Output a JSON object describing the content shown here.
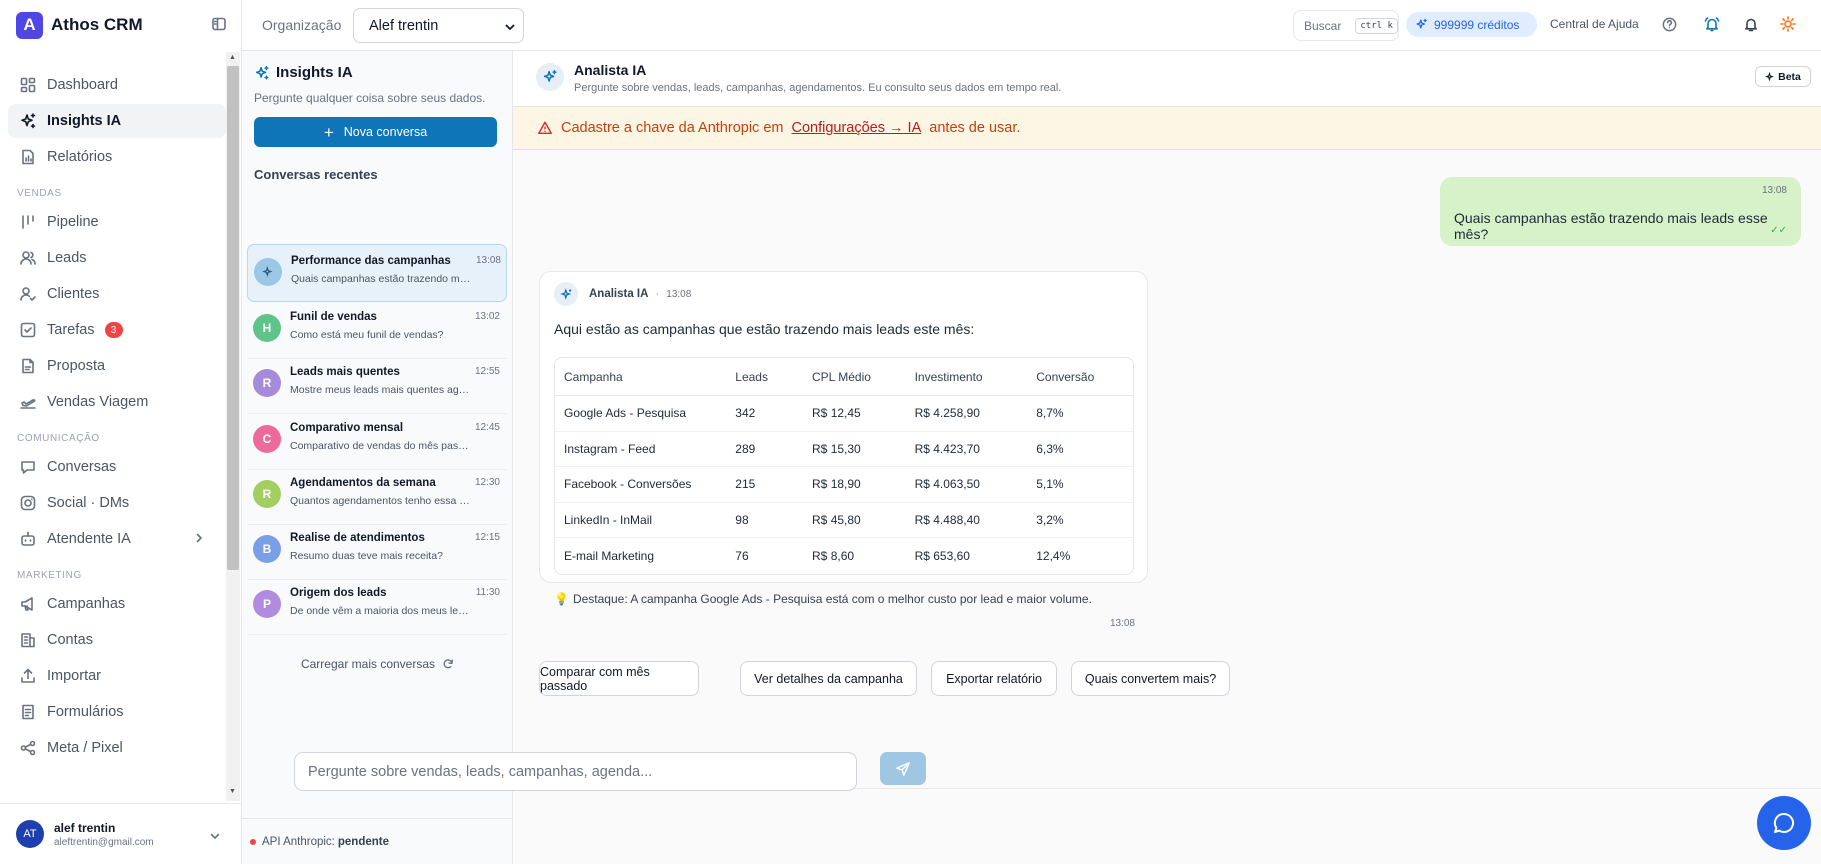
{
  "app": {
    "name": "Athos CRM",
    "logo_letter": "A"
  },
  "topbar": {
    "org_label": "Organização",
    "org_value": "Alef trentin",
    "search_label": "Buscar",
    "search_shortcut": "ctrl k",
    "credits": "999999 créditos",
    "help_link": "Central de Ajuda"
  },
  "sidebar": {
    "items_main": [
      {
        "label": "Dashboard",
        "icon": "dashboard-icon"
      },
      {
        "label": "Insights IA",
        "icon": "sparkles-icon",
        "active": true
      },
      {
        "label": "Relatórios",
        "icon": "file-chart-icon"
      }
    ],
    "section_vendas": "VENDAS",
    "items_vendas": [
      {
        "label": "Pipeline",
        "icon": "kanban-icon"
      },
      {
        "label": "Leads",
        "icon": "users-icon"
      },
      {
        "label": "Clientes",
        "icon": "user-check-icon"
      },
      {
        "label": "Tarefas",
        "icon": "checkbox-icon",
        "badge": "3"
      },
      {
        "label": "Proposta",
        "icon": "document-icon"
      },
      {
        "label": "Vendas Viagem",
        "icon": "plane-icon"
      }
    ],
    "section_comunicacao": "COMUNICAÇÃO",
    "items_comunicacao": [
      {
        "label": "Conversas",
        "icon": "chat-icon"
      },
      {
        "label": "Social · DMs",
        "icon": "instagram-icon"
      },
      {
        "label": "Atendente IA",
        "icon": "robot-icon",
        "has_chevron": true
      }
    ],
    "section_marketing": "MARKETING",
    "items_marketing": [
      {
        "label": "Campanhas",
        "icon": "megaphone-icon"
      },
      {
        "label": "Contas",
        "icon": "building-icon"
      },
      {
        "label": "Importar",
        "icon": "upload-icon"
      },
      {
        "label": "Formulários",
        "icon": "form-icon"
      },
      {
        "label": "Meta / Pixel",
        "icon": "share-icon"
      }
    ],
    "user": {
      "initials": "AT",
      "name": "alef trentin",
      "email": "aleftrentin@gmail.com"
    }
  },
  "conversations": {
    "title": "Insights IA",
    "subtitle": "Pergunte qualquer coisa sobre seus dados.",
    "new_button": "Nova conversa",
    "recent_label": "Conversas recentes",
    "items": [
      {
        "initial": "",
        "title": "Performance das campanhas",
        "time": "13:08",
        "preview": "Quais campanhas estão trazendo mais leads esse mês?",
        "color": "#9bc7e4",
        "active": true
      },
      {
        "initial": "H",
        "title": "Funil de vendas",
        "time": "13:02",
        "preview": "Como está meu funil de vendas?",
        "color": "#5ec48a"
      },
      {
        "initial": "R",
        "title": "Leads mais quentes",
        "time": "12:55",
        "preview": "Mostre meus leads mais quentes agora",
        "color": "#a78bdb"
      },
      {
        "initial": "C",
        "title": "Comparativo mensal",
        "time": "12:45",
        "preview": "Comparativo de vendas do mês passado",
        "color": "#ec6b9a"
      },
      {
        "initial": "R",
        "title": "Agendamentos da semana",
        "time": "12:30",
        "preview": "Quantos agendamentos tenho essa semana?",
        "color": "#a3cf62"
      },
      {
        "initial": "B",
        "title": "Realise de atendimentos",
        "time": "12:15",
        "preview": "Resumo duas teve mais receita?",
        "color": "#7a9fe6"
      },
      {
        "initial": "P",
        "title": "Origem dos leads",
        "time": "11:30",
        "preview": "De onde vêm a maioria dos meus leads",
        "color": "#b08be0"
      }
    ],
    "load_more": "Carregar mais conversas",
    "api_label": "API Anthropic:",
    "api_value": "pendente"
  },
  "chat": {
    "header_title": "Analista IA",
    "header_subtitle": "Pergunte sobre vendas, leads, campanhas, agendamentos. Eu consulto seus dados em tempo real.",
    "beta": "Beta",
    "warning_before": "Cadastre a chave da Anthropic em ",
    "warning_link": "Configurações → IA",
    "warning_after": " antes de usar.",
    "user_message": {
      "time": "13:08",
      "text": "Quais campanhas estão trazendo mais leads esse mês?"
    },
    "ai_message": {
      "name": "Analista IA",
      "time": "13:08",
      "intro": "Aqui estão as campanhas que estão trazendo mais leads este mês:",
      "columns": [
        "Campanha",
        "Leads",
        "CPL Médio",
        "Investimento",
        "Conversão"
      ],
      "rows": [
        [
          "Google Ads - Pesquisa",
          "342",
          "R$ 12,45",
          "R$ 4.258,90",
          "8,7%"
        ],
        [
          "Instagram - Feed",
          "289",
          "R$ 15,30",
          "R$ 4.423,70",
          "6,3%"
        ],
        [
          "Facebook - Conversões",
          "215",
          "R$ 18,90",
          "R$ 4.063,50",
          "5,1%"
        ],
        [
          "LinkedIn - InMail",
          "98",
          "R$ 45,80",
          "R$ 4.488,40",
          "3,2%"
        ],
        [
          "E-mail Marketing",
          "76",
          "R$ 8,60",
          "R$ 653,60",
          "12,4%"
        ]
      ],
      "highlight": "Destaque: A campanha Google Ads - Pesquisa está com o melhor custo por lead e maior volume.",
      "foot_time": "13:08"
    },
    "suggestions": [
      "Comparar com mês passado",
      "Ver detalhes da campanha",
      "Exportar relatório",
      "Quais convertem mais?"
    ],
    "input_placeholder": "Pergunte sobre vendas, leads, campanhas, agenda..."
  }
}
